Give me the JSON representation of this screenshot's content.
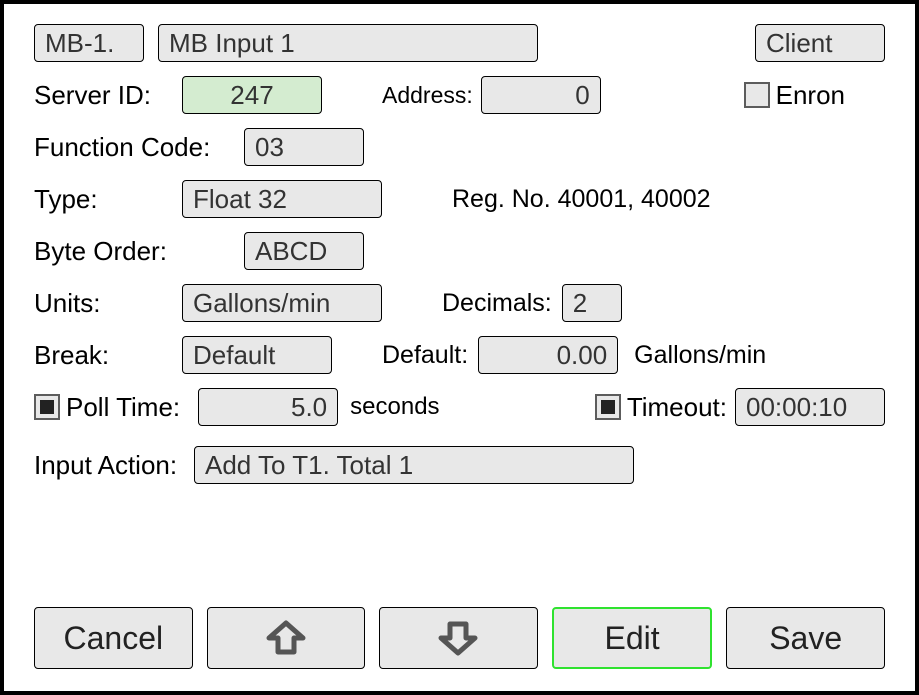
{
  "header": {
    "channel_button": "MB-1.",
    "name": "MB Input 1",
    "mode": "Client"
  },
  "server": {
    "label": "Server ID:",
    "id": "247",
    "address_label": "Address:",
    "address": "0",
    "enron_label": "Enron",
    "enron_checked": false
  },
  "function_code": {
    "label": "Function Code:",
    "value": "03"
  },
  "type": {
    "label": "Type:",
    "value": "Float 32",
    "reg_label": "Reg. No. 40001, 40002"
  },
  "byte_order": {
    "label": "Byte Order:",
    "value": "ABCD"
  },
  "units": {
    "label": "Units:",
    "value": "Gallons/min",
    "decimals_label": "Decimals:",
    "decimals": "2"
  },
  "break": {
    "label": "Break:",
    "value": "Default",
    "default_label": "Default:",
    "default_value": "0.00",
    "default_units": "Gallons/min"
  },
  "poll": {
    "poll_label": "Poll Time:",
    "poll_value": "5.0",
    "poll_units": "seconds",
    "poll_checked": true,
    "timeout_label": "Timeout:",
    "timeout_value": "00:00:10",
    "timeout_checked": true
  },
  "input_action": {
    "label": "Input Action:",
    "value": "Add To T1. Total 1"
  },
  "buttons": {
    "cancel": "Cancel",
    "edit": "Edit",
    "save": "Save"
  }
}
